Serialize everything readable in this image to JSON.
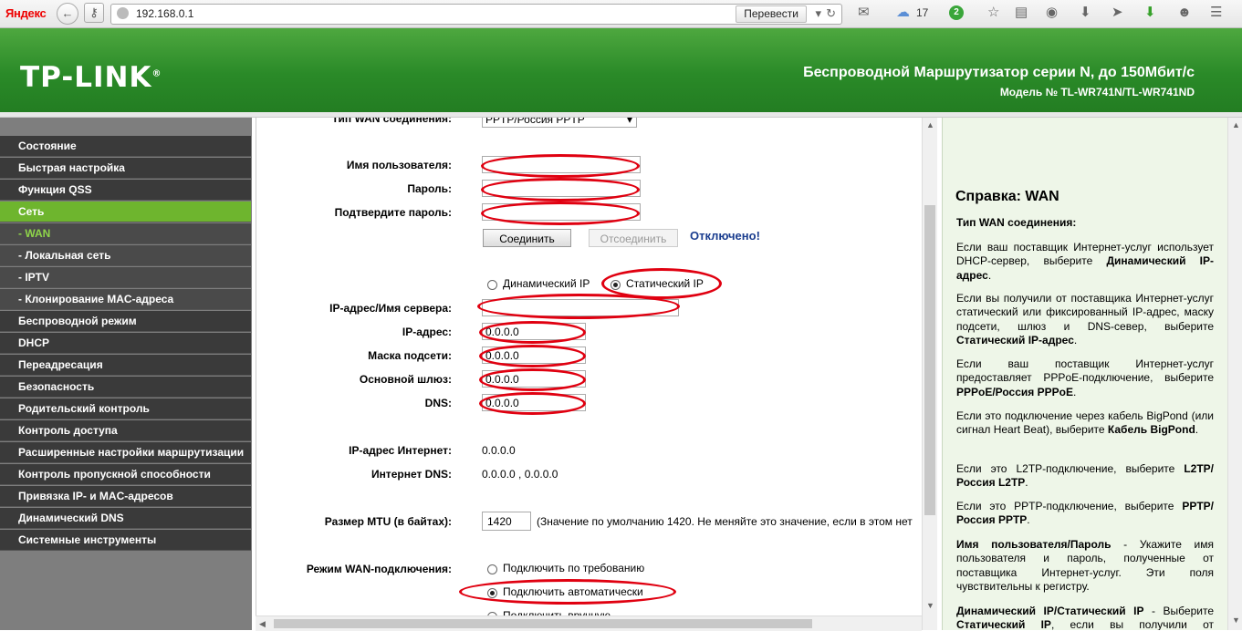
{
  "browser": {
    "brand": "Яндекс",
    "address": "192.168.0.1",
    "translate_label": "Перевести",
    "cloud_count": "17",
    "notification_count": "2"
  },
  "router": {
    "logo": "TP-LINK",
    "title": "Беспроводной Маршрутизатор серии N, до 150Мбит/с",
    "model": "Модель № TL-WR741N/TL-WR741ND"
  },
  "menu": [
    {
      "label": "Состояние",
      "state": "normal"
    },
    {
      "label": "Быстрая настройка",
      "state": "normal"
    },
    {
      "label": "Функция QSS",
      "state": "normal"
    },
    {
      "label": "Сеть",
      "state": "active"
    },
    {
      "label": "- WAN",
      "state": "sub-active"
    },
    {
      "label": "- Локальная сеть",
      "state": "sub"
    },
    {
      "label": "- IPTV",
      "state": "sub"
    },
    {
      "label": "- Клонирование MAC-адреса",
      "state": "sub"
    },
    {
      "label": "Беспроводной режим",
      "state": "normal"
    },
    {
      "label": "DHCP",
      "state": "normal"
    },
    {
      "label": "Переадресация",
      "state": "normal"
    },
    {
      "label": "Безопасность",
      "state": "normal"
    },
    {
      "label": "Родительский контроль",
      "state": "normal"
    },
    {
      "label": "Контроль доступа",
      "state": "normal"
    },
    {
      "label": "Расширенные настройки маршрутизации",
      "state": "normal"
    },
    {
      "label": "Контроль пропускной способности",
      "state": "normal"
    },
    {
      "label": "Привязка IP- и MAC-адресов",
      "state": "normal"
    },
    {
      "label": "Динамический DNS",
      "state": "normal"
    },
    {
      "label": "Системные инструменты",
      "state": "normal"
    }
  ],
  "form": {
    "wan_type_label": "Тип WAN соединения:",
    "wan_type_value": "PPTP/Россия PPTP",
    "username_label": "Имя пользователя:",
    "password_label": "Пароль:",
    "confirm_label": "Подтвердите пароль:",
    "connect_button": "Соединить",
    "disconnect_button": "Отсоединить",
    "status": "Отключено!",
    "dynamic_ip": "Динамический IP",
    "static_ip": "Статический IP",
    "server_label": "IP-адрес/Имя сервера:",
    "ip_label": "IP-адрес:",
    "ip_value": "0.0.0.0",
    "mask_label": "Маска подсети:",
    "mask_value": "0.0.0.0",
    "gateway_label": "Основной шлюз:",
    "gateway_value": "0.0.0.0",
    "dns_label": "DNS:",
    "dns_value": "0.0.0.0",
    "internet_ip_label": "IP-адрес Интернет:",
    "internet_ip_value": "0.0.0.0",
    "internet_dns_label": "Интернет DNS:",
    "internet_dns_value": "0.0.0.0 , 0.0.0.0",
    "mtu_label": "Размер MTU (в байтах):",
    "mtu_value": "1420",
    "mtu_hint": "(Значение по умолчанию 1420. Не меняйте это значение, если в этом нет",
    "wan_mode_label": "Режим WAN-подключения:",
    "mode_on_demand": "Подключить по требованию",
    "mode_auto": "Подключить автоматически",
    "mode_manual": "Подключить вручную"
  },
  "help": {
    "title": "Справка: WAN",
    "subtitle": "Тип WAN соединения:",
    "p1": "Если ваш поставщик Интернет-услуг использует DHCP-сервер, выберите ",
    "p1b": "Динамический IP-адрес",
    "p2": "Если вы получили от поставщика Интернет-услуг статический или фиксированный IP-адрес, маску подсети, шлюз и DNS-севeр, выберите ",
    "p2b": "Статический IP-адрес",
    "p3": "Если ваш поставщик Интернет-услуг предоставляет PPPoE-подключение, выберите ",
    "p3b": "PPPoE/Россия PPPoE",
    "p4": "Если это подключение через кабель BigPond (или сигнал Heart Beat), выберите ",
    "p4b": "Кабель BigPond",
    "p5": "Если это L2TP-подключение, выберите ",
    "p5b": "L2TP/Россия L2TP",
    "p6": "Если это PPTP-подключение, выберите ",
    "p6b": "PPTP/Россия PPTP",
    "p7b": "Имя пользователя/Пароль",
    "p7": " - Укажите имя пользователя и пароль, полученные от поставщика Интернет-услуг. Эти поля чувствительны к регистру.",
    "p8b": "Динамический IP/Статический IP",
    "p8": " - Выберите ",
    "p8c": "Статический IP",
    "p8d": ", если вы получили от поставщика"
  },
  "colors": {
    "header_green": "#2f8e2a",
    "menu_active": "#6eb52e",
    "annotation_red": "#e00010",
    "status_blue": "#1a3d8f"
  }
}
